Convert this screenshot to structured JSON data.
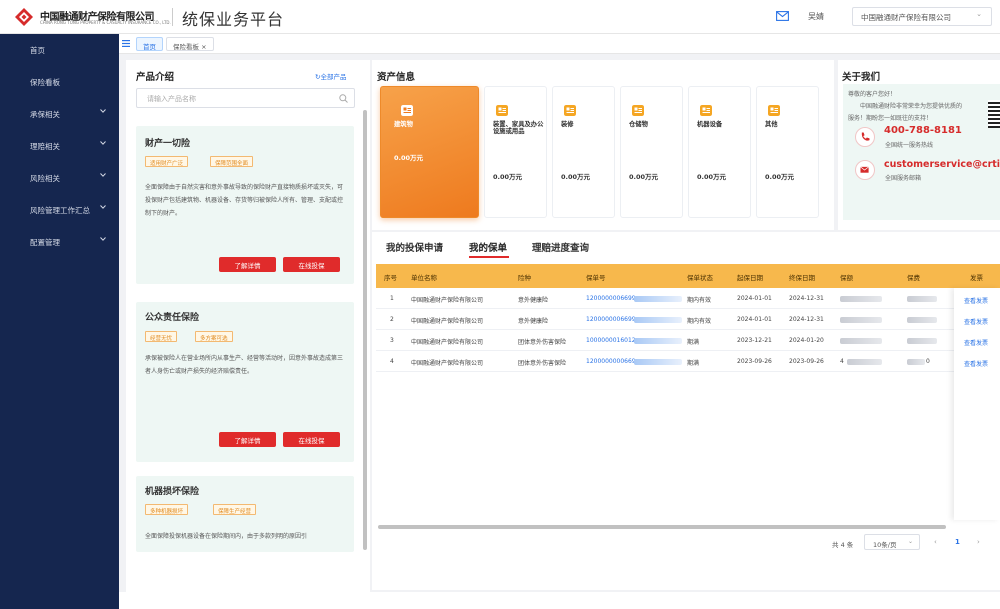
{
  "header": {
    "logo_cn": "中国融通财产保险有限公司",
    "logo_en": "CHINA RONG TONG PROPERTY & CASUALTY INSURANCE CO., LTD.",
    "app_title": "统保业务平台",
    "user_name": "吴婧",
    "company_select": "中国融通财产保险有限公司"
  },
  "sidebar": {
    "items": [
      {
        "label": "首页"
      },
      {
        "label": "保险看板"
      },
      {
        "label": "承保相关"
      },
      {
        "label": "理赔相关"
      },
      {
        "label": "风险相关"
      },
      {
        "label": "风险管理工作汇总"
      },
      {
        "label": "配置管理"
      }
    ]
  },
  "tabs": [
    {
      "label": "首页"
    },
    {
      "label": "保险看板 ×"
    }
  ],
  "products": {
    "title": "产品介绍",
    "all_link": "全部产品",
    "search_placeholder": "请输入产品名称",
    "items": [
      {
        "name": "财产一切险",
        "tags": [
          "适用财产广泛",
          "保障范围全面"
        ],
        "desc": "全面保障由于自然灾害和意外事故导致的保险财产直接物质损坏或灭失，可投保财产包括建筑物、机器设备、存货等归被保险人所有、管理、支配或控制下的财产。",
        "btn_detail": "了解详情",
        "btn_apply": "在线投保"
      },
      {
        "name": "公众责任保险",
        "tags": [
          "经营无忧",
          "多方案可选"
        ],
        "desc": "承保被保险人在营业场所内从事生产、经营等活动时，因意外事故造成第三者人身伤亡或财产损失的经济赔偿责任。",
        "btn_detail": "了解详情",
        "btn_apply": "在线投保"
      },
      {
        "name": "机器损坏保险",
        "tags": [
          "多种机器损坏",
          "保障生产经营"
        ],
        "desc": "全面保障投保机器设备在保险期间内，由于多款列明的原因引"
      }
    ]
  },
  "assets": {
    "title": "资产信息",
    "items": [
      {
        "name": "建筑物",
        "value": "0.00万元"
      },
      {
        "name": "装置、家具及办公设施或用品",
        "value": "0.00万元"
      },
      {
        "name": "装修",
        "value": "0.00万元"
      },
      {
        "name": "仓储物",
        "value": "0.00万元"
      },
      {
        "name": "机器设备",
        "value": "0.00万元"
      },
      {
        "name": "其他",
        "value": "0.00万元"
      }
    ]
  },
  "about": {
    "title": "关于我们",
    "greeting": "尊敬的客户您好！",
    "line1": "中国融通财险非常荣幸为您提供优质的",
    "line2": "服务！期盼您一如既往的支持！",
    "phone": "400-788-8181",
    "phone_note": "全国统一服务热线",
    "email": "customerservice@crtic.com",
    "email_note": "全国服务邮箱"
  },
  "policy_tabs": [
    {
      "label": "我的投保申请"
    },
    {
      "label": "我的保单"
    },
    {
      "label": "理赔进度查询"
    }
  ],
  "table": {
    "columns": [
      "序号",
      "单位名称",
      "险种",
      "保单号",
      "保单状态",
      "起保日期",
      "终保日期",
      "保额",
      "保费",
      "发票"
    ],
    "rows": [
      {
        "no": "1",
        "unit": "中国融通财产保险有限公司",
        "type": "意外健康险",
        "policy": "1200000006699",
        "status": "期内有效",
        "start": "2024-01-01",
        "end": "2024-12-31",
        "invoice": "查看发票"
      },
      {
        "no": "2",
        "unit": "中国融通财产保险有限公司",
        "type": "意外健康险",
        "policy": "1200000006699",
        "status": "期内有效",
        "start": "2024-01-01",
        "end": "2024-12-31",
        "invoice": "查看发票"
      },
      {
        "no": "3",
        "unit": "中国融通财产保险有限公司",
        "type": "团体意外伤害保险",
        "policy": "1000000016012",
        "status": "期满",
        "start": "2023-12-21",
        "end": "2024-01-20",
        "invoice": "查看发票"
      },
      {
        "no": "4",
        "unit": "中国融通财产保险有限公司",
        "type": "团体意外伤害保险",
        "policy": "1200000000669",
        "status": "期满",
        "start": "2023-09-26",
        "end": "2023-09-26",
        "invoice": "查看发票"
      }
    ],
    "partial_row3_amount": "4",
    "partial_row4_fee": "0"
  },
  "pager": {
    "total": "共 4 条",
    "page_size": "10条/页",
    "prev": "‹",
    "current": "1",
    "next": "›"
  },
  "colors": {
    "sidebar_bg": "#15264f",
    "header_orange": "#f7b84c",
    "accent_red": "#e02b2b",
    "link_blue": "#2a73e6",
    "mint_bg": "#eef7f4"
  }
}
